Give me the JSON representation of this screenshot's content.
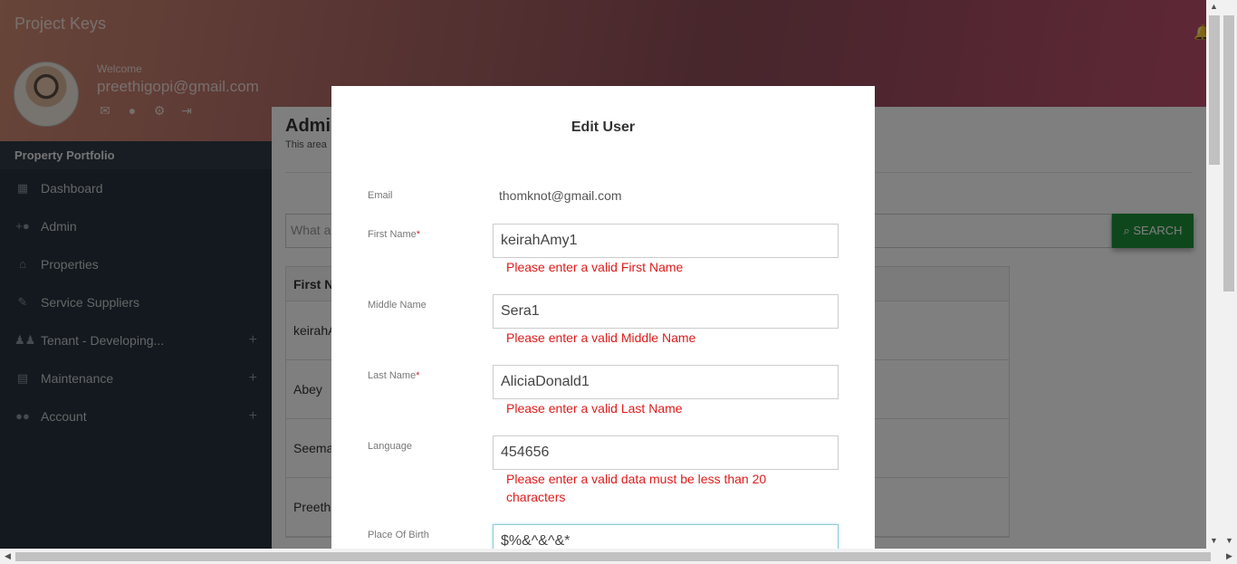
{
  "header": {
    "brand": "Project Keys",
    "welcome": "Welcome",
    "user_email": "preethigopi@gmail.com",
    "user_icons": [
      "mail-icon",
      "person-icon",
      "gear-icon",
      "logout-icon"
    ],
    "bell_icon": "bell-icon"
  },
  "sidebar": {
    "title": "Property Portfolio",
    "items": [
      {
        "label": "Dashboard",
        "icon": "dashboard-icon",
        "expandable": false
      },
      {
        "label": "Admin",
        "icon": "add-person-icon",
        "expandable": false
      },
      {
        "label": "Properties",
        "icon": "home-icon",
        "expandable": false
      },
      {
        "label": "Service Suppliers",
        "icon": "wrench-icon",
        "expandable": false
      },
      {
        "label": "Tenant - Developing...",
        "icon": "people-icon",
        "expandable": true
      },
      {
        "label": "Maintenance",
        "icon": "clipboard-icon",
        "expandable": true
      },
      {
        "label": "Account",
        "icon": "group-icon",
        "expandable": true
      }
    ],
    "expand_glyph": "+"
  },
  "panel": {
    "title": "Admi",
    "subtitle": "This area",
    "search_placeholder": "What a",
    "search_button": "SEARCH",
    "table_header": "First N",
    "rows": [
      "keirahA",
      "Abey",
      "Seema",
      "Preeth"
    ]
  },
  "modal": {
    "title": "Edit User",
    "email_label": "Email",
    "email_value": "thomknot@gmail.com",
    "fields": {
      "first_name": {
        "label": "First Name",
        "required": "*",
        "value": "keirahAmy1",
        "error": "Please enter a valid First Name"
      },
      "middle_name": {
        "label": "Middle Name",
        "value": "Sera1",
        "error": "Please enter a valid Middle Name"
      },
      "last_name": {
        "label": "Last Name",
        "required": "*",
        "value": "AliciaDonald1",
        "error": "Please enter a valid Last Name"
      },
      "language": {
        "label": "Language",
        "value": "454656",
        "error": "Please enter a valid data must be less than 20 characters"
      },
      "place_of_birth": {
        "label": "Place Of Birth",
        "value": "$%&^&^&*"
      }
    }
  },
  "colors": {
    "accent_green": "#1f8f3a",
    "error_red": "#e01b1b",
    "sidebar_bg": "#26323c"
  }
}
